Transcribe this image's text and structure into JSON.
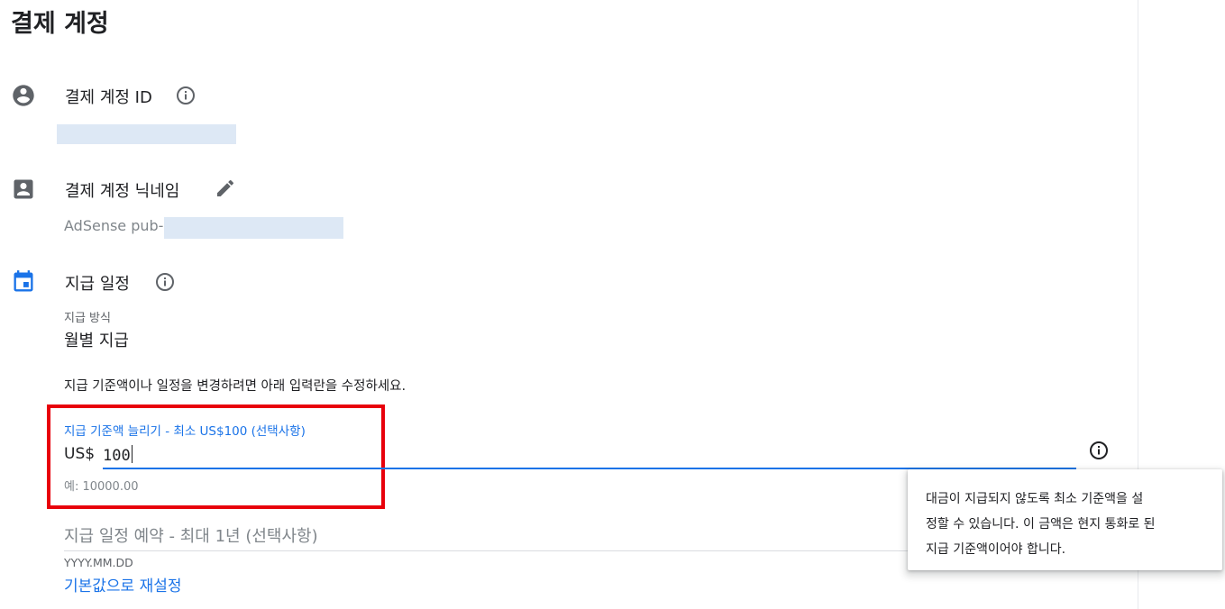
{
  "page_title": "결제 계정",
  "payment_account_id": {
    "label": "결제 계정 ID",
    "icon": "account-circle-icon",
    "info_icon": "info-icon"
  },
  "account_nickname": {
    "label": "결제 계정 닉네임",
    "icon": "contact-card-icon",
    "edit_icon": "pencil-icon",
    "value_prefix": "AdSense pub-"
  },
  "payment_schedule": {
    "label": "지급 일정",
    "icon": "calendar-icon",
    "info_icon": "info-icon",
    "method_label": "지급 방식",
    "method_value": "월별 지급",
    "hint": "지급 기준액이나 일정을 변경하려면 아래 입력란을 수정하세요."
  },
  "threshold_field": {
    "label": "지급 기준액 늘리기 - 최소 US$100 (선택사항)",
    "prefix": "US$",
    "value": "100",
    "example": "예: 10000.00",
    "help_icon": "info-icon"
  },
  "schedule_field": {
    "placeholder": "지급 일정 예약 - 최대 1년 (선택사항)",
    "format": "YYYY.MM.DD",
    "reset_link": "기본값으로 재설정"
  },
  "tooltip": {
    "lines": [
      "대금이 지급되지 않도록 최소 기준액을 설",
      "정할 수 있습니다. 이 금액은 현지 통화로 된",
      "지급 기준액이어야 합니다."
    ]
  },
  "colors": {
    "accent": "#1a73e8",
    "highlight_box": "#e8000b",
    "masked_value": "#dde8f5"
  }
}
